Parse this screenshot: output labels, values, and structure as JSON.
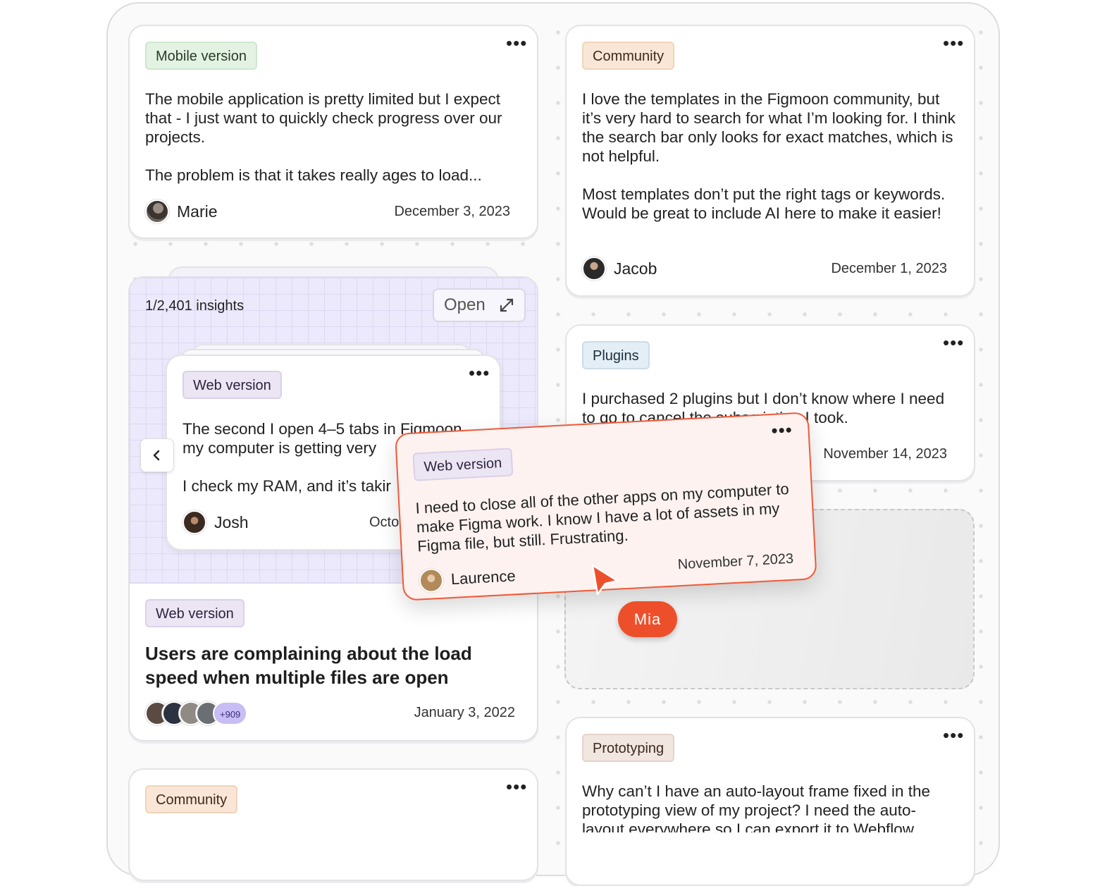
{
  "cards": {
    "marie": {
      "tag": "Mobile version",
      "p1": "The mobile application is pretty limited but I expect that - I just want to quickly check progress over our projects.",
      "p2": "The problem is that it takes really ages to load...",
      "author": "Marie",
      "date": "December 3, 2023"
    },
    "jacob": {
      "tag": "Community",
      "p1": "I love the templates in the Figmoon community, but it’s very hard to search for what I’m looking for. I think the search bar only looks for exact matches, which is not helpful.",
      "p2": "Most templates don’t put the right tags or keywords. Would be great to include AI here to make it easier!",
      "author": "Jacob",
      "date": "December 1, 2023"
    },
    "plugins": {
      "tag": "Plugins",
      "p1": "I purchased 2 plugins but I don’t know where I need to go to cancel the subscription I took.",
      "date": "November 14, 2023"
    },
    "prototyping": {
      "tag": "Prototyping",
      "p1": "Why can’t I have an auto-layout frame fixed in the prototyping view of my project? I need the auto-layout everywhere so I can export it to Webflow."
    },
    "community_bottom": {
      "tag": "Community"
    }
  },
  "insight_panel": {
    "counter": "1/2,401 insights",
    "open_label": "Open",
    "inner_card": {
      "tag": "Web version",
      "p1": "The second I open 4–5 tabs in Figmoon my computer is getting very",
      "p2": "I check my RAM, and it’s takir",
      "author": "Josh",
      "date": "Octo"
    },
    "tag": "Web version",
    "title": "Users are complaining about the load speed when multiple files are open",
    "extra_count": "+909",
    "date": "January 3, 2022"
  },
  "dragged_card": {
    "tag": "Web version",
    "p1": "I need to close all of the other apps on my computer to make Figma work. I know I have a lot of assets in my Figma file, but still. Frustrating.",
    "author": "Laurence",
    "date": "November 7, 2023"
  },
  "cursor": {
    "user": "Mia",
    "color": "#ee4f2b"
  },
  "colors": {
    "accent": "#ee5a3a",
    "panel_bg": "#ebe9fb"
  }
}
